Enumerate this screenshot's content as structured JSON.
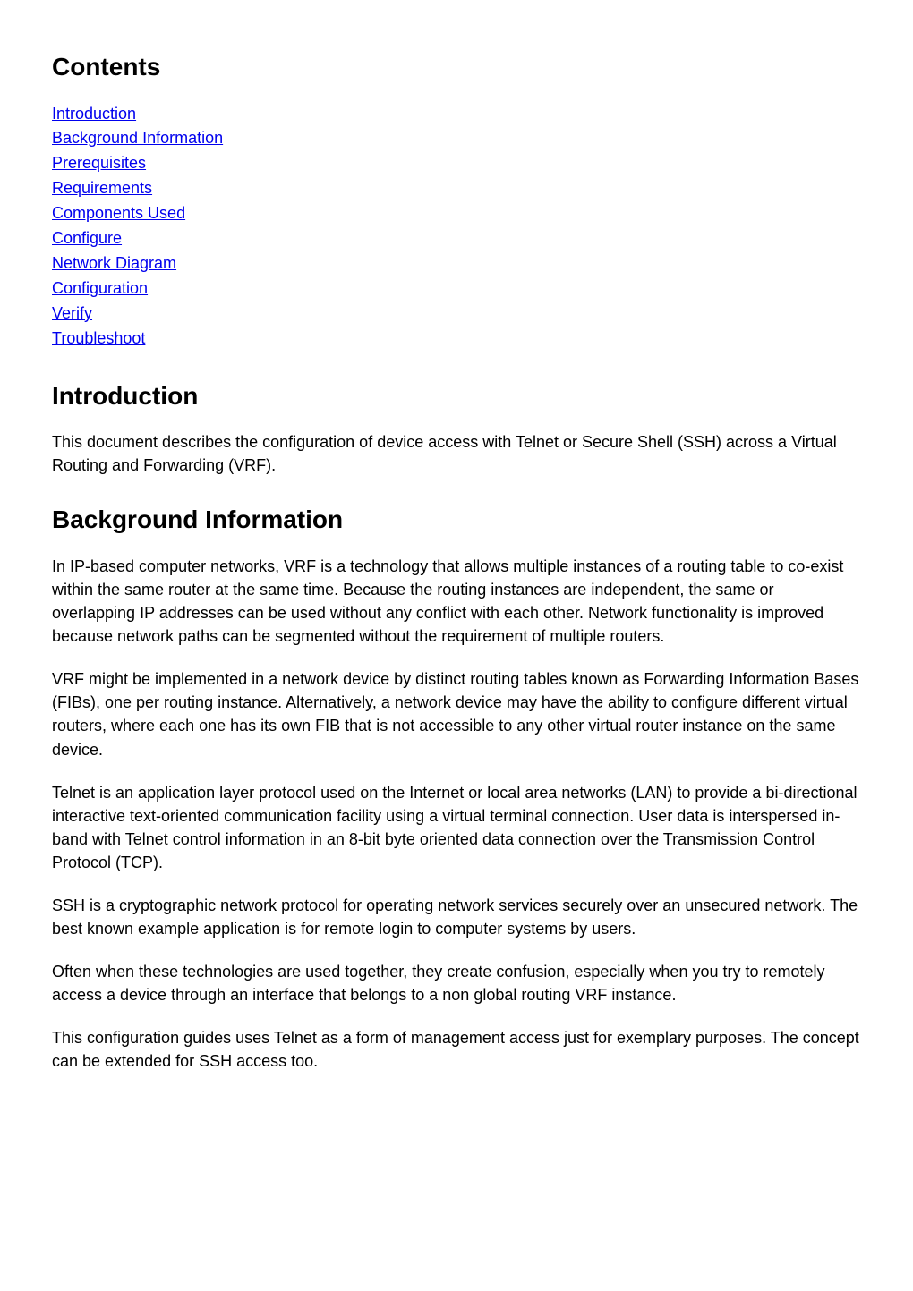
{
  "headings": {
    "contents": "Contents",
    "introduction": "Introduction",
    "background": "Background Information"
  },
  "toc": {
    "introduction": "Introduction",
    "background": "Background Information",
    "prerequisites": "Prerequisites ",
    "requirements": "Requirements",
    "components_used": "Components Used",
    "configure": "Configure",
    "network_diagram": "Network Diagram",
    "configuration": "Configuration",
    "verify": "Verify",
    "troubleshoot": "Troubleshoot"
  },
  "body": {
    "intro_p1": "This document describes the configuration of device access with Telnet or Secure Shell (SSH) across a Virtual Routing and Forwarding (VRF).",
    "bg_p1": "In IP-based computer networks, VRF is a technology that allows multiple instances of a routing table to co-exist within the same router at the same time. Because the routing instances are independent, the same or overlapping IP addresses can be used without any conflict with each other. Network functionality is improved because network paths can be segmented without the requirement of multiple routers.",
    "bg_p2": "VRF might be implemented in a network device by distinct routing tables known as Forwarding Information Bases (FIBs), one per routing instance. Alternatively, a network device may have the ability to configure different virtual routers, where each one has its own FIB that is not accessible to any other virtual router instance on the same device.",
    "bg_p3": "Telnet is an application layer protocol used on the Internet or local area networks (LAN) to provide a bi-directional interactive text-oriented communication facility using a virtual terminal connection. User data is interspersed in-band with Telnet control information in an 8-bit byte oriented data connection over the Transmission Control Protocol (TCP).",
    "bg_p4": "SSH is a cryptographic network protocol for operating network services securely over an unsecured network. The best known example application is for remote login to computer systems by users.",
    "bg_p5": "Often when these technologies are used together, they create confusion, especially when you try to remotely access a device through an interface that belongs to a non global routing VRF instance.",
    "bg_p6": "This configuration guides uses Telnet as a form of management access just for exemplary purposes. The concept can be extended for SSH access too."
  }
}
